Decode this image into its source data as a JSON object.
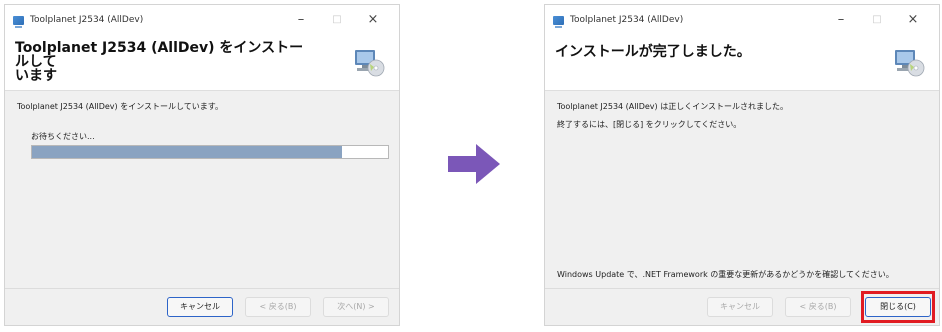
{
  "colors": {
    "arrow": "#7b57b8",
    "progress_fill": "#8aa3c1",
    "highlight": "#e11b22",
    "panel_bg": "#f0f0f0"
  },
  "left_window": {
    "title": "Toolplanet J2534 (AllDev)",
    "header_title": "Toolplanet J2534 (AllDev) をインストールして\nいます",
    "status_message": "Toolplanet J2534 (AllDev) をインストールしています。",
    "wait_label": "お待ちください...",
    "progress": 0.87,
    "buttons": {
      "cancel": "キャンセル",
      "back": "< 戻る(B)",
      "next": "次へ(N) >"
    }
  },
  "right_window": {
    "title": "Toolplanet J2534 (AllDev)",
    "header_title": "インストールが完了しました。",
    "message1": "Toolplanet J2534 (AllDev) は正しくインストールされました。",
    "message2": "終了するには、[閉じる] をクリックしてください。",
    "update_message": "Windows Update で、.NET Framework の重要な更新があるかどうかを確認してください。",
    "buttons": {
      "cancel": "キャンセル",
      "back": "< 戻る(B)",
      "close": "閉じる(C)"
    }
  },
  "icons": {
    "app": "installer-app-icon",
    "header": "computer-cd-icon",
    "minimize": "minimize-icon",
    "maximize": "maximize-icon",
    "close": "close-icon",
    "arrow": "right-arrow-icon"
  }
}
